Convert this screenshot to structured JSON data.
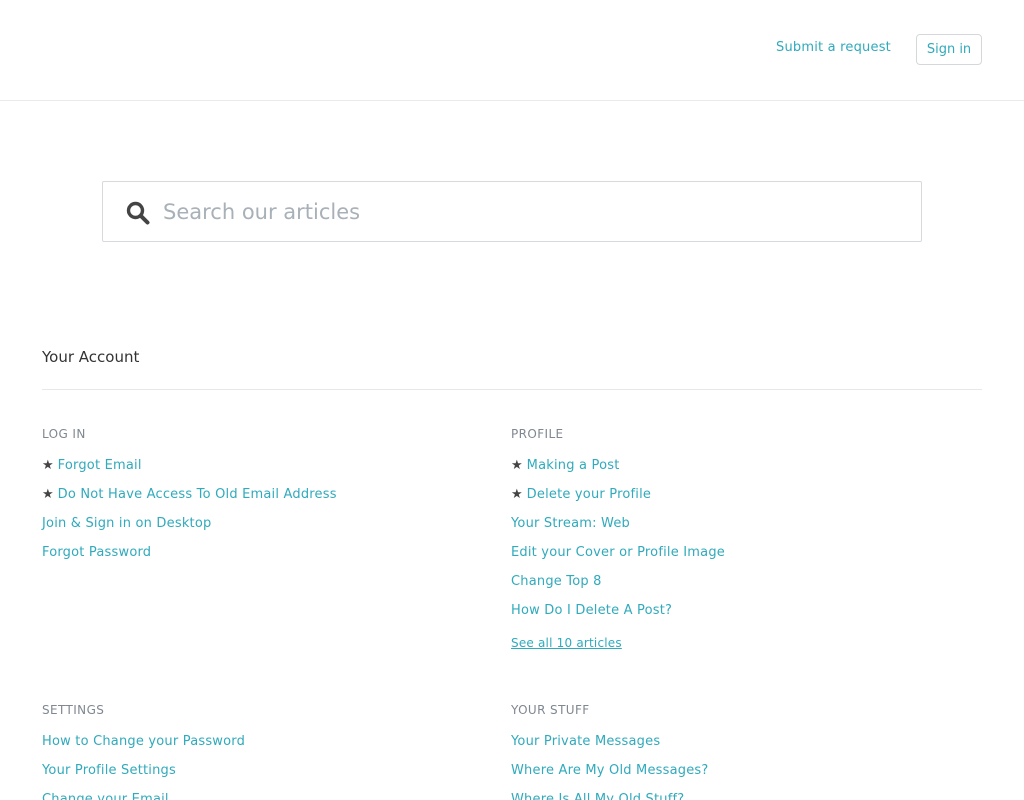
{
  "header": {
    "submit_request": "Submit a request",
    "sign_in": "Sign in"
  },
  "search": {
    "placeholder": "Search our articles"
  },
  "category": {
    "title": "Your Account"
  },
  "sections": {
    "log_in": {
      "title": "Log in",
      "articles": [
        {
          "label": "Forgot Email",
          "promoted": true
        },
        {
          "label": "Do Not Have Access To Old Email Address",
          "promoted": true
        },
        {
          "label": "Join & Sign in on Desktop",
          "promoted": false
        },
        {
          "label": "Forgot Password",
          "promoted": false
        }
      ]
    },
    "profile": {
      "title": "Profile",
      "articles": [
        {
          "label": "Making a Post",
          "promoted": true
        },
        {
          "label": "Delete your Profile",
          "promoted": true
        },
        {
          "label": "Your Stream: Web",
          "promoted": false
        },
        {
          "label": "Edit your Cover or Profile Image",
          "promoted": false
        },
        {
          "label": "Change Top 8",
          "promoted": false
        },
        {
          "label": "How Do I Delete A Post?",
          "promoted": false
        }
      ],
      "see_all": "See all 10 articles"
    },
    "settings": {
      "title": "Settings",
      "articles": [
        {
          "label": "How to Change your Password",
          "promoted": false
        },
        {
          "label": "Your Profile Settings",
          "promoted": false
        },
        {
          "label": "Change your Email",
          "promoted": false
        }
      ]
    },
    "your_stuff": {
      "title": "Your Stuff",
      "articles": [
        {
          "label": "Your Private Messages",
          "promoted": false
        },
        {
          "label": "Where Are My Old Messages?",
          "promoted": false
        },
        {
          "label": "Where Is All My Old Stuff?",
          "promoted": false
        }
      ]
    }
  },
  "icons": {
    "star": "★",
    "search": "search-icon"
  },
  "colors": {
    "link": "#30aabc",
    "text": "#333333",
    "muted": "#7f8790",
    "border": "#d6dadd"
  }
}
